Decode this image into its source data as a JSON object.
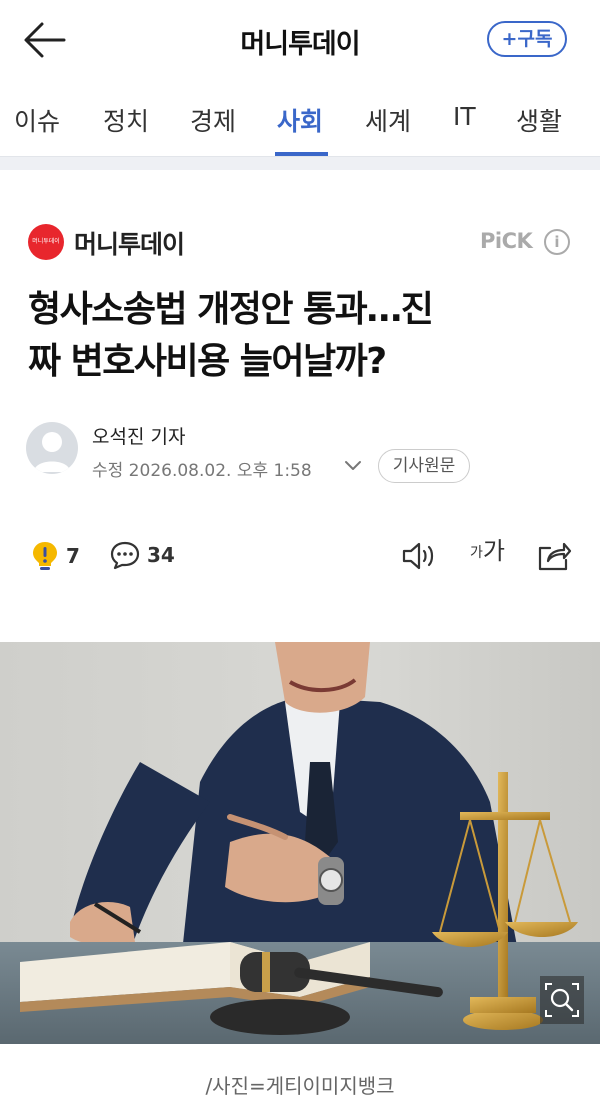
{
  "header": {
    "title": "머니투데이",
    "subscribe_label": "+구독"
  },
  "tabs": [
    {
      "label": "이슈"
    },
    {
      "label": "정치"
    },
    {
      "label": "경제"
    },
    {
      "label": "사회"
    },
    {
      "label": "세계"
    },
    {
      "label": "IT"
    },
    {
      "label": "생활"
    }
  ],
  "active_tab": "사회",
  "article": {
    "press_name": "머니투데이",
    "press_logo_text": "머니투데이",
    "pick_label": "PiCK",
    "info_icon": "i",
    "headline_line1": "형사소송법 개정안 통과…진",
    "headline_line2": "짜 변호사비용 늘어날까?",
    "author": "오석진 기자",
    "date": "수정 2026.08.02. 오후 1:58",
    "source_label": "기사원문",
    "reactions": {
      "count": "7"
    },
    "comments": {
      "count": "34"
    },
    "font_size_label_small": "가",
    "font_size_label_large": "가",
    "photo_caption": "/사진=게티이미지뱅크"
  },
  "colors": {
    "accent": "#3a67c9",
    "press_logo": "#e8262d",
    "reaction_icon": "#f5b800"
  },
  "icons": {
    "back": "arrow-left-icon",
    "info": "info-circle-icon",
    "chevron": "chevron-down-icon",
    "reaction": "exclamation-bulb-icon",
    "comment": "speech-bubble-icon",
    "speaker": "speaker-icon",
    "font_size": "font-size-icon",
    "share": "share-icon",
    "zoom": "zoom-icon"
  }
}
